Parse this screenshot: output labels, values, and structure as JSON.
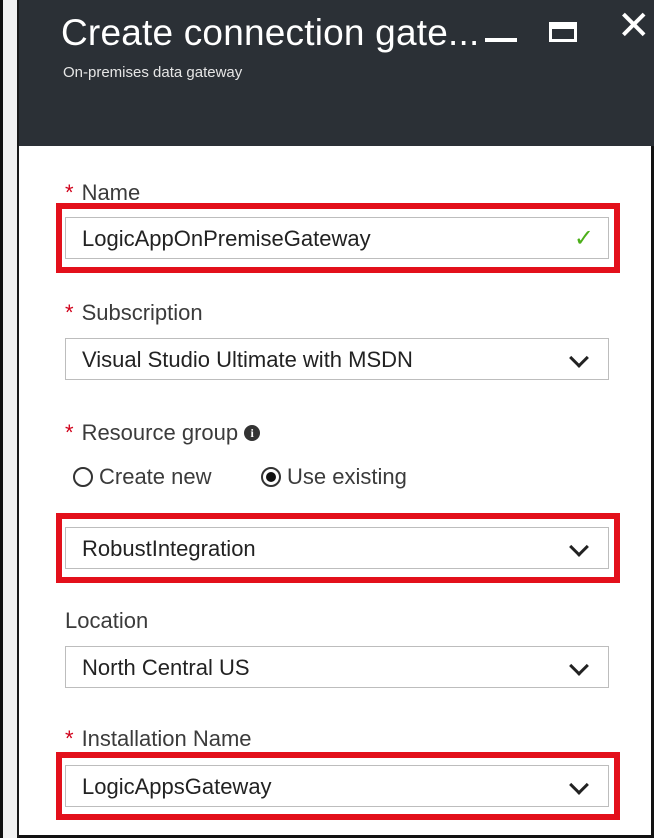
{
  "window": {
    "title": "Create connection gate...",
    "subtitle": "On-premises data gateway"
  },
  "required_marker": "*",
  "form": {
    "name": {
      "label": "Name",
      "value": "LogicAppOnPremiseGateway"
    },
    "subscription": {
      "label": "Subscription",
      "value": "Visual Studio Ultimate with MSDN"
    },
    "resource_group": {
      "label": "Resource group",
      "info_icon": "i",
      "option_create_new": "Create new",
      "option_use_existing": "Use existing",
      "selected_option": "Use existing",
      "value": "RobustIntegration"
    },
    "location": {
      "label": "Location",
      "value": "North Central US"
    },
    "installation_name": {
      "label": "Installation Name",
      "value": "LogicAppsGateway"
    }
  },
  "colors": {
    "header_bg": "#2b3036",
    "highlight": "#e3101b",
    "required": "#d0021b",
    "valid_check": "#4caf1a"
  }
}
